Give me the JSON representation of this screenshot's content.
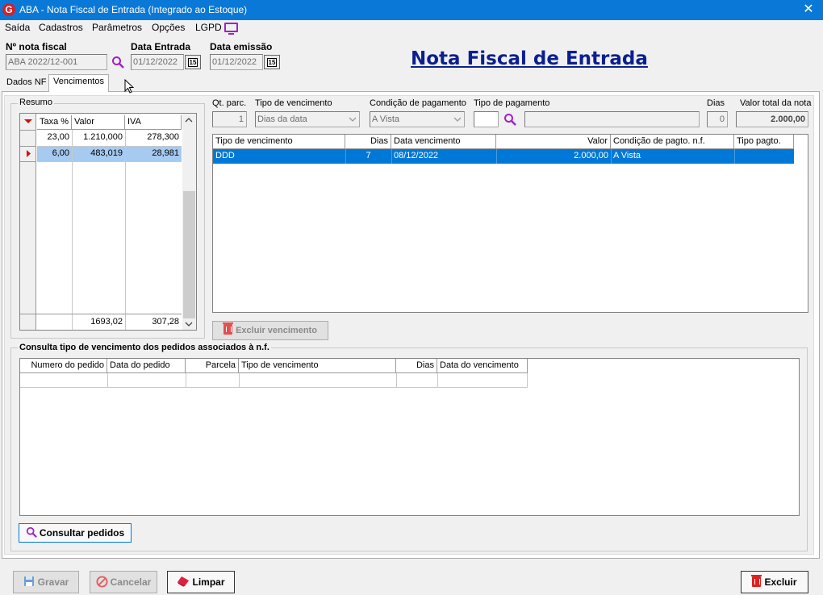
{
  "window": {
    "title": "ABA - Nota Fiscal de Entrada (Integrado ao Estoque)",
    "app_icon": "G",
    "close_glyph": "✕"
  },
  "menu": {
    "items": [
      "Saída",
      "Cadastros",
      "Parâmetros",
      "Opções",
      "LGPD"
    ]
  },
  "header": {
    "nota_fiscal_label": "Nº nota fiscal",
    "nota_fiscal_value": "ABA 2022/12-001",
    "data_entrada_label": "Data Entrada",
    "data_entrada_value": "01/12/2022",
    "data_emissao_label": "Data emissão",
    "data_emissao_value": "01/12/2022",
    "calendar_text": "15",
    "page_title": "Nota Fiscal de Entrada"
  },
  "tabs": [
    {
      "label": "Dados NF",
      "active": false
    },
    {
      "label": "Vencimentos",
      "active": true
    }
  ],
  "resumo": {
    "title": "Resumo",
    "columns": [
      "Taxa %",
      "Valor",
      "IVA"
    ],
    "rows": [
      {
        "taxa": "23,00",
        "valor": "1.210,000",
        "iva": "278,300",
        "selected": false
      },
      {
        "taxa": "6,00",
        "valor": "483,019",
        "iva": "28,981",
        "selected": true
      }
    ],
    "totals": {
      "valor": "1693,02",
      "iva": "307,28"
    }
  },
  "vencimentos": {
    "qt_parc_label": "Qt. parc.",
    "qt_parc_value": "1",
    "tipo_venc_label": "Tipo de vencimento",
    "tipo_venc_value": "Dias da data",
    "condicao_label": "Condição de pagamento",
    "condicao_value": "A Vista",
    "tipo_pag_label": "Tipo de pagamento",
    "tipo_pag_value": "",
    "tipo_pag_desc": "",
    "dias_label": "Dias",
    "dias_value": "0",
    "valor_total_label": "Valor total da nota",
    "valor_total_value": "2.000,00",
    "grid_columns": [
      "Tipo de vencimento",
      "Dias",
      "Data vencimento",
      "Valor",
      "Condição de pagto. n.f.",
      "Tipo pagto."
    ],
    "grid_rows": [
      {
        "tipo": "DDD",
        "dias": "7",
        "data": "08/12/2022",
        "valor": "2.000,00",
        "condicao": "A Vista",
        "tipo_pagto": ""
      }
    ],
    "excluir_label": "Excluir vencimento"
  },
  "consulta": {
    "title": "Consulta tipo de vencimento dos pedidos associados à n.f.",
    "columns": [
      "Numero do pedido",
      "Data do pedido",
      "Parcela",
      "Tipo de vencimento",
      "Dias",
      "Data do vencimento"
    ],
    "button_label": "Consultar pedidos"
  },
  "footer": {
    "gravar": "Gravar",
    "cancelar": "Cancelar",
    "limpar": "Limpar",
    "excluir": "Excluir"
  },
  "colors": {
    "titlebar": "#0a78d7",
    "selection": "#0078d7",
    "title_blue": "#0b1f90",
    "accent_purple": "#a020c8",
    "trash_red": "#e02020"
  }
}
